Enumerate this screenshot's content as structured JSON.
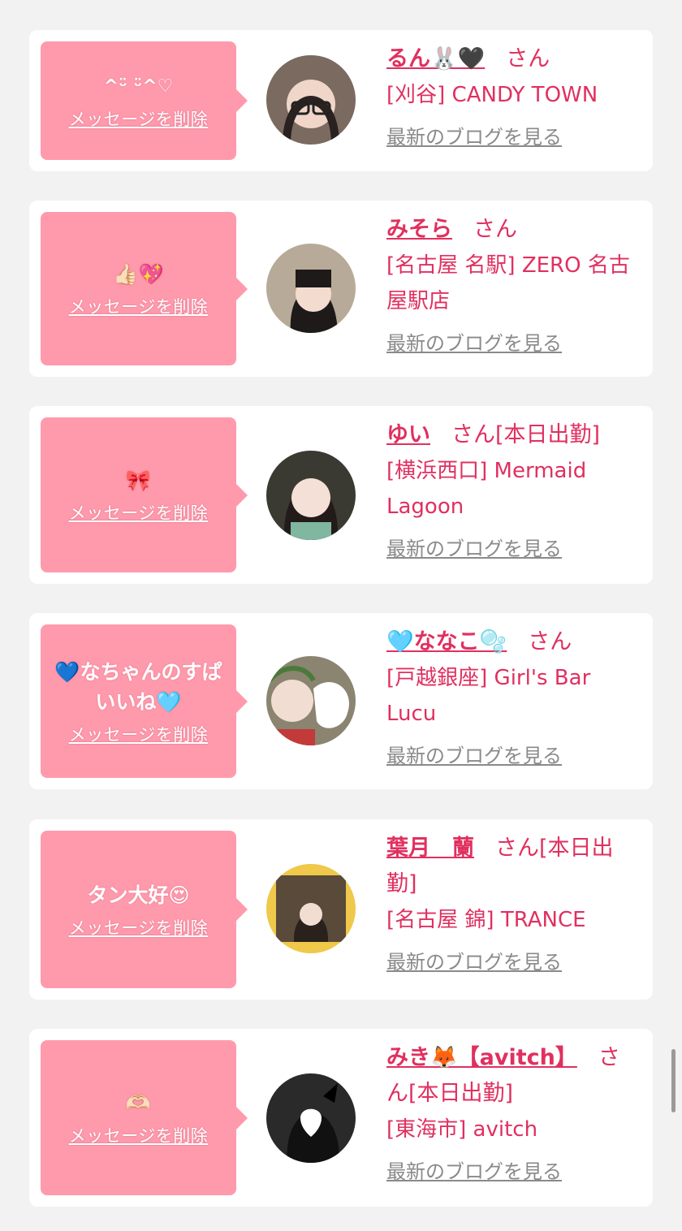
{
  "cards": [
    {
      "message": "^ᵕ̈ ᵕ̈^♡",
      "delete_label": "メッセージを削除",
      "name": "るん🐰🖤",
      "san": "さん",
      "shop": "[刈谷] CANDY TOWN",
      "blog_label": "最新のブログを見る"
    },
    {
      "message": "👍🏻💖",
      "delete_label": "メッセージを削除",
      "name": "みそら",
      "san": "さん",
      "shop": "[名古屋 名駅] ZERO 名古屋駅店",
      "blog_label": "最新のブログを見る"
    },
    {
      "message": "🎀",
      "delete_label": "メッセージを削除",
      "name": "ゆい",
      "san": "さん[本日出勤]",
      "shop": "[横浜西口] Mermaid Lagoon",
      "blog_label": "最新のブログを見る"
    },
    {
      "message": "💙なちゃんのすぱいいね🩵",
      "delete_label": "メッセージを削除",
      "name": "🩵ななこ🫧",
      "san": "さん",
      "shop": "[戸越銀座] Girl's Bar Lucu",
      "blog_label": "最新のブログを見る"
    },
    {
      "message": "タン大好😍",
      "delete_label": "メッセージを削除",
      "name": "葉月　蘭",
      "san": "さん[本日出勤]",
      "shop": "[名古屋 錦] TRANCE",
      "blog_label": "最新のブログを見る"
    },
    {
      "message": "🫶🏻",
      "delete_label": "メッセージを削除",
      "name": "みき🦊【avitch】",
      "san": "さん[本日出勤]",
      "shop": "[東海市] avitch",
      "blog_label": "最新のブログを見る"
    }
  ]
}
